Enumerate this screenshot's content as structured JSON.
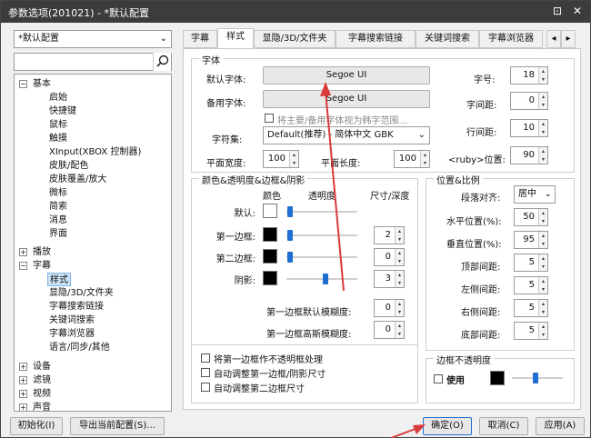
{
  "window": {
    "title": "参数选项(201021) - *默认配置",
    "close_glyph": "✕",
    "pin_glyph": "⊡"
  },
  "profile": {
    "value": "*默认配置"
  },
  "search": {
    "value": ""
  },
  "tree": {
    "basic": "基本",
    "basic_children": [
      "启始",
      "快捷键",
      "鼠标",
      "触摸",
      "XInput(XBOX 控制器)",
      "皮肤/配色",
      "皮肤覆盖/放大",
      "微标",
      "简索",
      "消息",
      "界面"
    ],
    "playback": "播放",
    "subtitle": "字幕",
    "subtitle_children": [
      "样式",
      "显隐/3D/文件夹",
      "字幕搜索链接",
      "关键词搜索",
      "字幕浏览器",
      "语言/同步/其他"
    ],
    "device": "设备",
    "filter": "滤镜",
    "video": "视频",
    "audio": "声音"
  },
  "tabs": [
    "字幕",
    "样式",
    "显隐/3D/文件夹",
    "字幕搜索链接",
    "关键词搜索",
    "字幕浏览器"
  ],
  "font": {
    "group_title": "字体",
    "default_font_label": "默认字体:",
    "default_font": "Segoe UI",
    "backup_font_label": "备用字体:",
    "backup_font": "Segoe UI",
    "korean_checkbox": "将主要/备用字体视为韩字范围...",
    "charset_label": "字符集:",
    "charset": "Default(推荐) - 简体中文 GBK",
    "hscale_label": "平面宽度:",
    "hscale": "100",
    "vscale_label": "平面长度:",
    "vscale": "100",
    "size_label": "字号:",
    "size": "18",
    "spacing_label": "字间距:",
    "spacing": "0",
    "line_spacing_label": "行间距:",
    "line_spacing": "10",
    "ruby_label": "<ruby>位置:",
    "ruby": "90"
  },
  "color": {
    "group_title": "颜色&透明度&边框&阴影",
    "col_color": "颜色",
    "col_opacity": "透明度",
    "col_size": "尺寸/深度",
    "rows": [
      {
        "label": "默认:",
        "color": "#ffffff",
        "opacity": 0.02,
        "size": ""
      },
      {
        "label": "第一边框:",
        "color": "#000000",
        "opacity": 0.02,
        "size": "2"
      },
      {
        "label": "第二边框:",
        "color": "#000000",
        "opacity": 0.02,
        "size": "0"
      },
      {
        "label": "阴影:",
        "color": "#000000",
        "opacity": 0.55,
        "size": "3"
      }
    ],
    "blur1_label": "第一边框默认模糊度:",
    "blur1": "0",
    "blur2_label": "第一边框高斯模糊度:",
    "blur2": "0",
    "cb_opaque": "将第一边框作不透明框处理",
    "cb_auto1": "自动调整第一边框/阴影尺寸",
    "cb_auto2": "自动调整第二边框尺寸"
  },
  "position": {
    "group_title": "位置&比例",
    "align_label": "段落对齐:",
    "align": "居中",
    "h_label": "水平位置(%):",
    "h": "50",
    "v_label": "垂直位置(%):",
    "v": "95",
    "top_label": "顶部间距:",
    "top": "5",
    "left_label": "左侧间距:",
    "left": "5",
    "right_label": "右侧间距:",
    "right": "5",
    "bottom_label": "底部间距:",
    "bottom": "5"
  },
  "border_opacity": {
    "group_title": "边框不透明度",
    "use_label": "使用",
    "opacity": 0.45
  },
  "footer": {
    "init": "初始化(I)",
    "export": "导出当前配置(S)...",
    "ok": "确定(O)",
    "cancel": "取消(C)",
    "apply": "应用(A)"
  },
  "colors": {
    "accent": "#1e6fd0",
    "annotation": "#d93a3a"
  }
}
